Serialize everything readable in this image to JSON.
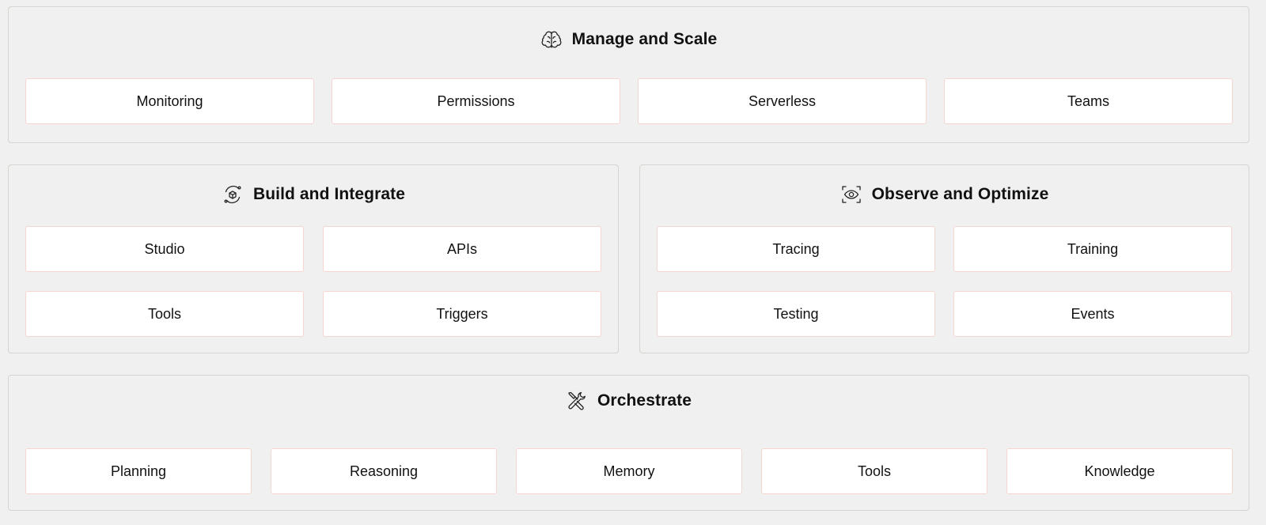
{
  "manage": {
    "title": "Manage and Scale",
    "icon": "brain-icon",
    "items": [
      "Monitoring",
      "Permissions",
      "Serverless",
      "Teams"
    ]
  },
  "build": {
    "title": "Build and Integrate",
    "icon": "cube-cycle-icon",
    "items": [
      "Studio",
      "APIs",
      "Tools",
      "Triggers"
    ]
  },
  "observe": {
    "title": "Observe and Optimize",
    "icon": "eye-scan-icon",
    "items": [
      "Tracing",
      "Training",
      "Testing",
      "Events"
    ]
  },
  "orchestrate": {
    "title": "Orchestrate",
    "icon": "wrench-screwdriver-icon",
    "items": [
      "Planning",
      "Reasoning",
      "Memory",
      "Tools",
      "Knowledge"
    ]
  }
}
